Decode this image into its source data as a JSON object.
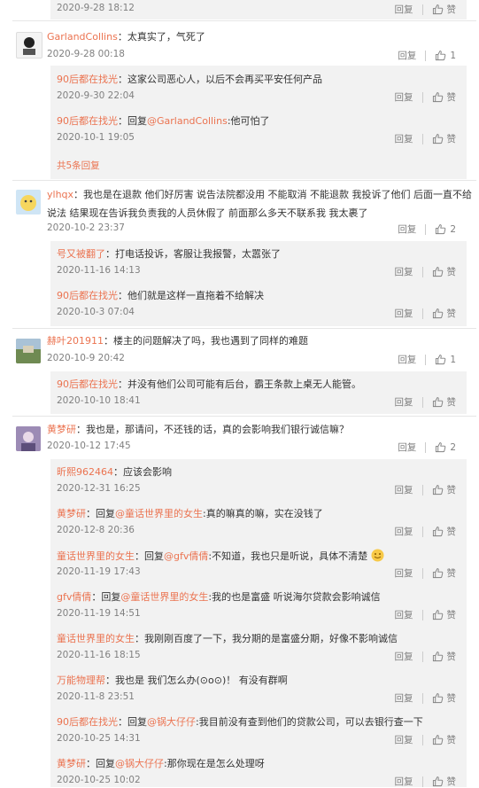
{
  "labels": {
    "reply": "回复",
    "like": "赞"
  },
  "comments": [
    {
      "time": "2020-9-28 18:12",
      "likes": ""
    },
    {
      "user": "GarlandCollins",
      "text": "：太真实了，气死了",
      "time": "2020-9-28 00:18",
      "likes": "1"
    },
    {
      "user": "90后都在找光",
      "text": "：这家公司恶心人，以后不会再买平安任何产品",
      "time": "2020-9-30 22:04"
    },
    {
      "user": "90后都在找光",
      "pre": "：回复",
      "at": "@GarlandCollins",
      "text": ":他可怕了",
      "time": "2020-10-1 19:05"
    },
    {
      "more": "共5条回复"
    },
    {
      "user": "ylhqx",
      "text1": "：我也是在退款 他们好厉害 说告法院都没用 不能取消 不能退款 我投诉了他们  后面一直不给",
      "text2": "说法 结果现在告诉我负责我的人员休假了 前面那么多天不联系我 我太裹了",
      "time": "2020-10-2 23:37",
      "likes": "2"
    },
    {
      "user": "号又被翻了",
      "text": "：打电话投诉，客服让我报警，太嚣张了",
      "time": "2020-11-16 14:13"
    },
    {
      "user": "90后都在找光",
      "text": "：他们就是这样一直拖着不给解决",
      "time": "2020-10-3 07:04"
    },
    {
      "user": "赫叶201911",
      "text": "：楼主的问题解决了吗，我也遇到了同样的难题",
      "time": "2020-10-9 20:42",
      "likes": "1"
    },
    {
      "user": "90后都在找光",
      "text": "：并没有他们公司可能有后台，霸王条款上桌无人能管。",
      "time": "2020-10-10 18:41"
    },
    {
      "user": "黄梦研",
      "text": "：我也是，那请问，不还钱的话，真的会影响我们银行诚信嘛？",
      "time": "2020-10-12 17:45",
      "likes": "2"
    },
    {
      "user": "昕熙962464",
      "text": "：应该会影响",
      "time": "2020-12-31 16:25"
    },
    {
      "user": "黄梦研",
      "pre": "：回复",
      "at": "@童话世界里的女生",
      "text": ":真的嘛真的嘛，实在没钱了",
      "time": "2020-12-8 20:36"
    },
    {
      "user": "童话世界里的女生",
      "pre": "：回复",
      "at": "@gfv倩倩",
      "text": ":不知道，我也只是听说，具体不清楚",
      "time": "2020-11-19 17:43"
    },
    {
      "user": "gfv倩倩",
      "pre": "：回复",
      "at": "@童话世界里的女生",
      "text": ":我的也是富盛  听说海尔贷款会影响诚信",
      "time": "2020-11-19 14:51"
    },
    {
      "user": "童话世界里的女生",
      "text": "：我刚刚百度了一下，我分期的是富盛分期，好像不影响诚信",
      "time": "2020-11-16 18:15"
    },
    {
      "user": "万能物理帮",
      "text": "：我也是 我们怎么办(⊙o⊙)！ 有没有群啊",
      "time": "2020-11-8 23:51"
    },
    {
      "user": "90后都在找光",
      "pre": "：回复",
      "at": "@锅大仔仔",
      "text": ":我目前没有查到他们的贷款公司，可以去银行查一下",
      "time": "2020-10-25 14:31"
    },
    {
      "user": "黄梦研",
      "pre": "：回复",
      "at": "@锅大仔仔",
      "text": ":那你现在是怎么处理呀",
      "time": "2020-10-25 10:02"
    }
  ]
}
